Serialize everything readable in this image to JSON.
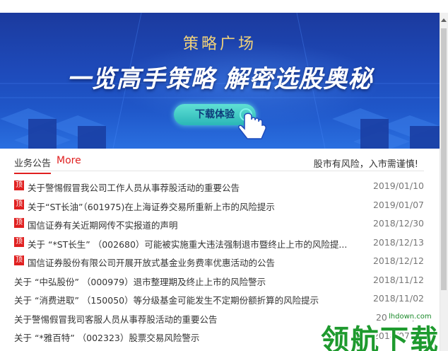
{
  "banner": {
    "subtitle": "策略广场",
    "title": "一览高手策略  解密选股奥秘",
    "button_label": "下载体验"
  },
  "tabs": {
    "active_label": "业务公告",
    "more_label": "More",
    "risk_notice": "股市有风险，入市需谨慎!"
  },
  "notices": [
    {
      "pinned": true,
      "badge": "顶",
      "title": "关于警惕假冒我公司工作人员从事荐股活动的重要公告",
      "date": "2019/01/10"
    },
    {
      "pinned": true,
      "badge": "顶",
      "title": "关于“ST长油”（601975)在上海证券交易所重新上市的风险提示",
      "date": "2019/01/07"
    },
    {
      "pinned": true,
      "badge": "顶",
      "title": "国信证券有关近期网传不实报道的声明",
      "date": "2018/12/30"
    },
    {
      "pinned": true,
      "badge": "顶",
      "title": "关于 “*ST长生” （002680）可能被实施重大违法强制退市暨终止上市的风险提...",
      "date": "2018/12/13"
    },
    {
      "pinned": true,
      "badge": "顶",
      "title": "国信证券股份有限公司开展开放式基金业务费率优惠活动的公告",
      "date": "2018/12/12"
    },
    {
      "pinned": false,
      "title": "关于 “中弘股份” （000979）退市整理期及终止上市的风险警示",
      "date": "2018/11/12"
    },
    {
      "pinned": false,
      "title": "关于 “消费进取” （150050）等分级基金可能发生不定期份额折算的风险提示",
      "date": "2018/11/02"
    },
    {
      "pinned": false,
      "title": "关于警惕假冒我司客服人员从事荐股活动的重要公告",
      "date": "2018/10/..."
    },
    {
      "pinned": false,
      "title": "关于 “*雅百特” （002323）股票交易风险警示",
      "date": "2018/07/06"
    }
  ],
  "watermark": {
    "text": "领航下载",
    "url": "lhdown.com"
  },
  "colors": {
    "accent": "#e02020",
    "banner_blue": "#1e4bbb",
    "gold": "#f1d27a"
  }
}
